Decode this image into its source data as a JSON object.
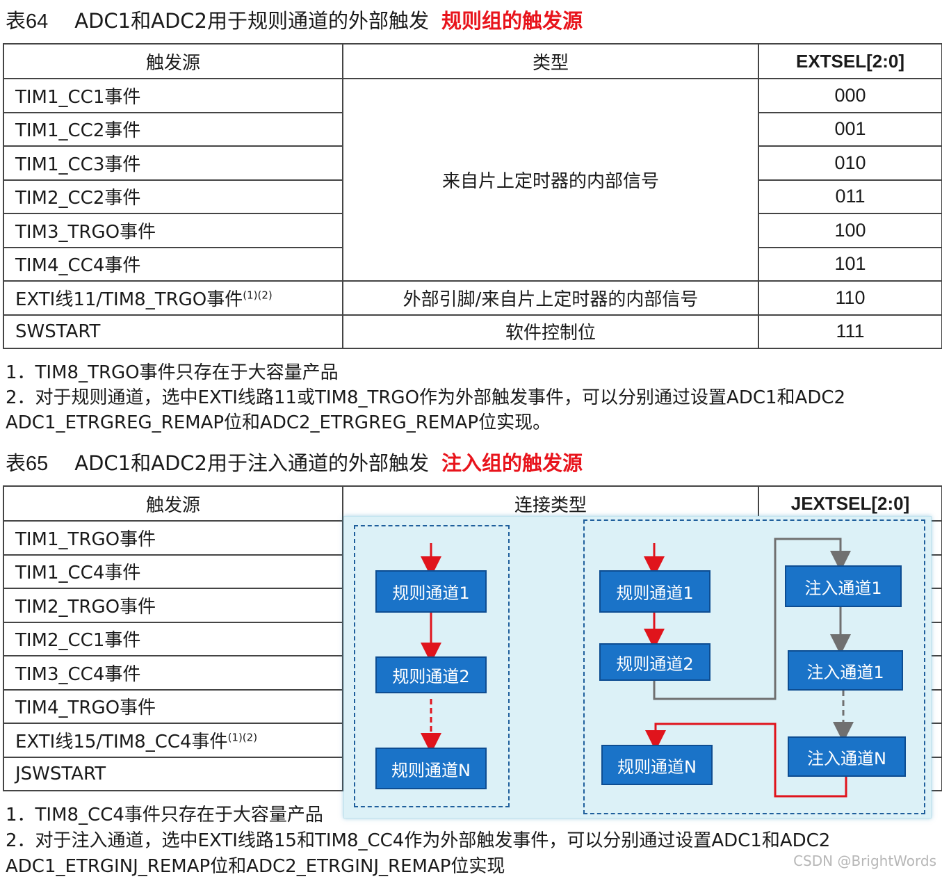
{
  "table64": {
    "caption_num": "表64",
    "caption": "ADC1和ADC2用于规则通道的外部触发",
    "highlight": "规则组的触发源",
    "headers": {
      "source": "触发源",
      "type": "类型",
      "extsel": "EXTSEL[2:0]"
    },
    "rows": [
      {
        "source": "TIM1_CC1事件",
        "value": "000"
      },
      {
        "source": "TIM1_CC2事件",
        "value": "001"
      },
      {
        "source": "TIM1_CC3事件",
        "value": "010"
      },
      {
        "source": "TIM2_CC2事件",
        "value": "011"
      },
      {
        "source": "TIM3_TRGO事件",
        "value": "100"
      },
      {
        "source": "TIM4_CC4事件",
        "value": "101"
      },
      {
        "source": "EXTI线11/TIM8_TRGO事件",
        "sup": "(1)(2)",
        "value": "110",
        "type": "外部引脚/来自片上定时器的内部信号"
      },
      {
        "source": "SWSTART",
        "value": "111",
        "type": "软件控制位"
      }
    ],
    "merged_type": "来自片上定时器的内部信号",
    "notes": [
      "1．TIM8_TRGO事件只存在于大容量产品",
      "2．对于规则通道，选中EXTI线路11或TIM8_TRGO作为外部触发事件，可以分别通过设置ADC1和ADC2",
      "ADC1_ETRGREG_REMAP位和ADC2_ETRGREG_REMAP位实现。"
    ]
  },
  "table65": {
    "caption_num": "表65",
    "caption": "ADC1和ADC2用于注入通道的外部触发",
    "highlight": "注入组的触发源",
    "headers": {
      "source": "触发源",
      "type": "连接类型",
      "jextsel": "JEXTSEL[2:0]"
    },
    "rows": [
      {
        "source": "TIM1_TRGO事件"
      },
      {
        "source": "TIM1_CC4事件"
      },
      {
        "source": "TIM2_TRGO事件"
      },
      {
        "source": "TIM2_CC1事件"
      },
      {
        "source": "TIM3_CC4事件"
      },
      {
        "source": "TIM4_TRGO事件"
      },
      {
        "source": "EXTI线15/TIM8_CC4事件",
        "sup": "(1)(2)"
      },
      {
        "source": "JSWSTART"
      }
    ],
    "notes": [
      "1．TIM8_CC4事件只存在于大容量产品",
      "2．对于注入通道，选中EXTI线路15和TIM8_CC4作为外部触发事件，可以分别通过设置ADC1和ADC2",
      "ADC1_ETRGINJ_REMAP位和ADC2_ETRGINJ_REMAP位实现"
    ]
  },
  "diagram": {
    "left": [
      "规则通道1",
      "规则通道2",
      "规则通道N"
    ],
    "right_regular": [
      "规则通道1",
      "规则通道2",
      "规则通道N"
    ],
    "right_injected": [
      "注入通道1",
      "注入通道1",
      "注入通道N"
    ],
    "colors": {
      "box": "#1a73c8",
      "arrow_red": "#e0141c",
      "arrow_gray": "#707070",
      "overlay": "#dcf1f7"
    }
  },
  "watermark": "CSDN @BrightWords"
}
